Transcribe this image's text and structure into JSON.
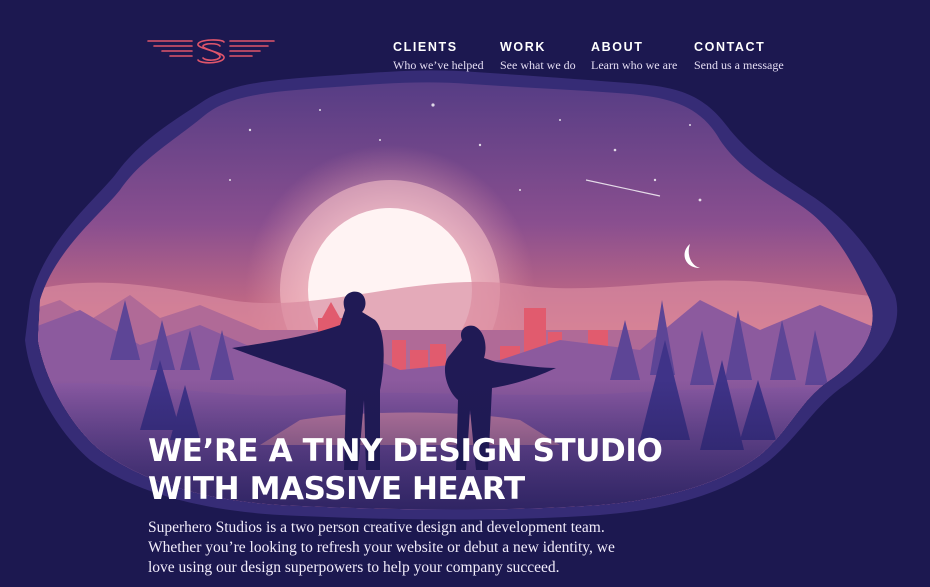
{
  "colors": {
    "background": "#1c1850",
    "accent_logo": "#e0556b",
    "sky_top": "#5b3f86",
    "sky_glow": "#f29a9a",
    "silhouette": "#201a55"
  },
  "logo": {
    "icon": "winged-s-logo-icon"
  },
  "nav": {
    "items": [
      {
        "title": "CLIENTS",
        "subtitle": "Who we’ve helped"
      },
      {
        "title": "WORK",
        "subtitle": "See what we do"
      },
      {
        "title": "ABOUT",
        "subtitle": "Learn who we are"
      },
      {
        "title": "CONTACT",
        "subtitle": "Send us a message"
      }
    ]
  },
  "hero": {
    "headline_line1": "WE’RE A TINY DESIGN STUDIO",
    "headline_line2": "WITH MASSIVE HEART",
    "description": "Superhero Studios is a two person creative design and development team. Whether you’re looking to refresh your website or debut a new identity, we love using our design superpowers to help your company succeed."
  }
}
